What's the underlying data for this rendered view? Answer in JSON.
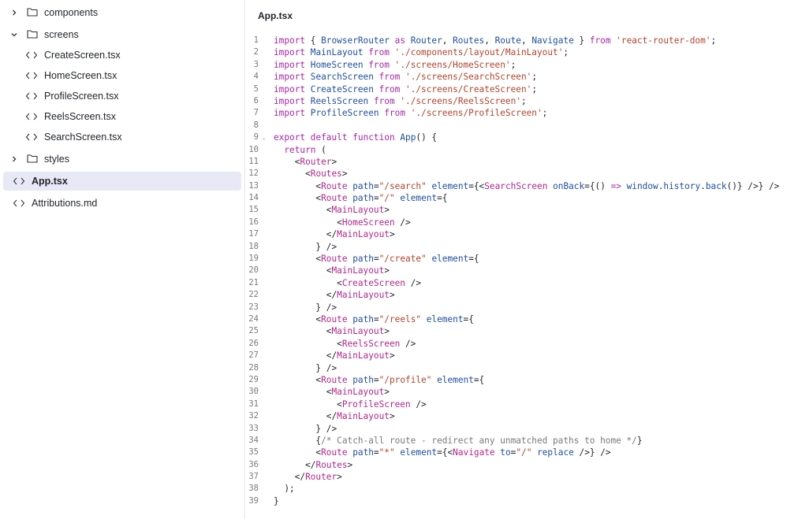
{
  "sidebar": {
    "items": [
      {
        "label": "components",
        "kind": "folder",
        "expanded": false,
        "depth": 0
      },
      {
        "label": "screens",
        "kind": "folder",
        "expanded": true,
        "depth": 0
      },
      {
        "label": "CreateScreen.tsx",
        "kind": "file",
        "depth": 1
      },
      {
        "label": "HomeScreen.tsx",
        "kind": "file",
        "depth": 1
      },
      {
        "label": "ProfileScreen.tsx",
        "kind": "file",
        "depth": 1
      },
      {
        "label": "ReelsScreen.tsx",
        "kind": "file",
        "depth": 1
      },
      {
        "label": "SearchScreen.tsx",
        "kind": "file",
        "depth": 1
      },
      {
        "label": "styles",
        "kind": "folder",
        "expanded": false,
        "depth": 0
      },
      {
        "label": "App.tsx",
        "kind": "file",
        "depth": 0,
        "active": true
      },
      {
        "label": "Attributions.md",
        "kind": "file",
        "depth": 0
      }
    ]
  },
  "editor": {
    "filename": "App.tsx",
    "lines": [
      "import { BrowserRouter as Router, Routes, Route, Navigate } from 'react-router-dom';",
      "import MainLayout from './components/layout/MainLayout';",
      "import HomeScreen from './screens/HomeScreen';",
      "import SearchScreen from './screens/SearchScreen';",
      "import CreateScreen from './screens/CreateScreen';",
      "import ReelsScreen from './screens/ReelsScreen';",
      "import ProfileScreen from './screens/ProfileScreen';",
      "",
      "export default function App() {",
      "  return (",
      "    <Router>",
      "      <Routes>",
      "        <Route path=\"/search\" element={<SearchScreen onBack={() => window.history.back()} />} />",
      "        <Route path=\"/\" element={",
      "          <MainLayout>",
      "            <HomeScreen />",
      "          </MainLayout>",
      "        } />",
      "        <Route path=\"/create\" element={",
      "          <MainLayout>",
      "            <CreateScreen />",
      "          </MainLayout>",
      "        } />",
      "        <Route path=\"/reels\" element={",
      "          <MainLayout>",
      "            <ReelsScreen />",
      "          </MainLayout>",
      "        } />",
      "        <Route path=\"/profile\" element={",
      "          <MainLayout>",
      "            <ProfileScreen />",
      "          </MainLayout>",
      "        } />",
      "        {/* Catch-all route - redirect any unmatched paths to home */}",
      "        <Route path=\"*\" element={<Navigate to=\"/\" replace />} />",
      "      </Routes>",
      "    </Router>",
      "  );",
      "}"
    ],
    "fold_line": 9
  },
  "icons": {
    "chevron_right": "chevron-right-icon",
    "chevron_down": "chevron-down-icon",
    "folder": "folder-icon",
    "code": "code-file-icon",
    "fold": "fold-toggle-icon"
  },
  "colors": {
    "active_row": "#e8e9f7",
    "keyword": "#a626a4",
    "identifier": "#1f4e9c",
    "string": "#b0442c",
    "tag": "#b0268c",
    "comment": "#7a7a7a"
  }
}
